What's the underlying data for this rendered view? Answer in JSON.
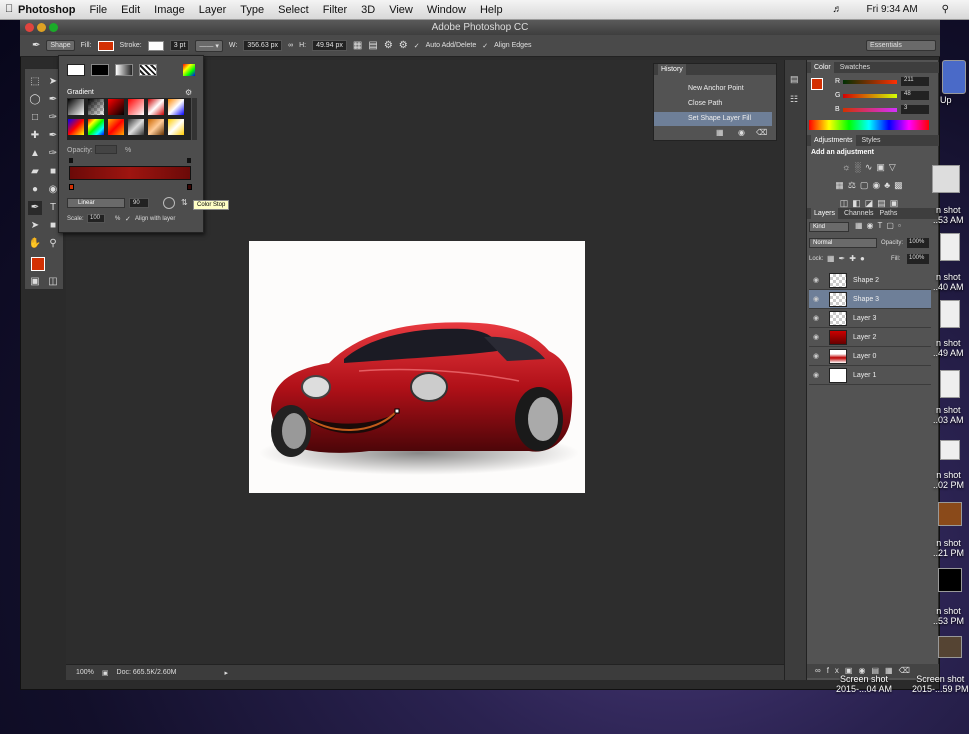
{
  "menubar": {
    "app": "Photoshop",
    "items": [
      "File",
      "Edit",
      "Image",
      "Layer",
      "Type",
      "Select",
      "Filter",
      "3D",
      "View",
      "Window",
      "Help"
    ],
    "clock": "Fri 9:34 AM"
  },
  "window": {
    "title": "Adobe Photoshop CC"
  },
  "options": {
    "mode": "Shape",
    "fill_label": "Fill:",
    "stroke_label": "Stroke:",
    "stroke_width": "3 pt",
    "w_label": "W:",
    "w_value": "356.63 px",
    "h_label": "H:",
    "h_value": "49.94 px",
    "auto_add": "Auto Add/Delete",
    "align_edges": "Align Edges",
    "workspace": "Essentials"
  },
  "gradient_panel": {
    "title": "Gradient",
    "opacity_label": "Opacity:",
    "opacity_unit": "%",
    "type": "Linear",
    "angle": "90",
    "scale_label": "Scale:",
    "scale_value": "100",
    "scale_unit": "%",
    "align_label": "Align with layer",
    "tooltip": "Color Stop"
  },
  "history": {
    "title": "History",
    "items": [
      "New Anchor Point",
      "Close Path",
      "Set Shape Layer Fill"
    ]
  },
  "color_panel": {
    "tabs": [
      "Color",
      "Swatches"
    ],
    "r_label": "R",
    "r_value": "211",
    "g_label": "G",
    "g_value": "48",
    "b_label": "B",
    "b_value": "3"
  },
  "adjustments": {
    "tabs": [
      "Adjustments",
      "Styles"
    ],
    "heading": "Add an adjustment"
  },
  "layers": {
    "tabs": [
      "Layers",
      "Channels",
      "Paths"
    ],
    "kind": "Kind",
    "blend": "Normal",
    "opacity_label": "Opacity:",
    "opacity_value": "100%",
    "lock_label": "Lock:",
    "fill_label": "Fill:",
    "fill_value": "100%",
    "items": [
      "Shape 2",
      "Shape 3",
      "Layer 3",
      "Layer 2",
      "Layer 0",
      "Layer 1"
    ]
  },
  "status": {
    "zoom": "100%",
    "doc": "Doc: 665.5K/2.60M"
  },
  "desktop": {
    "labels": [
      "n shot\n..53 AM",
      "n shot\n..40 AM",
      "n shot\n..49 AM",
      "n shot\n..03 AM",
      "n shot\n..02 PM",
      "n shot\n..21 PM",
      "n shot\n..53 PM",
      "Screen shot\n2015-...04 AM",
      "Screen shot\n2015-...59 PM"
    ],
    "up": "Up"
  },
  "colors": {
    "fill": "#d33003",
    "accent": "#6e7f98"
  }
}
